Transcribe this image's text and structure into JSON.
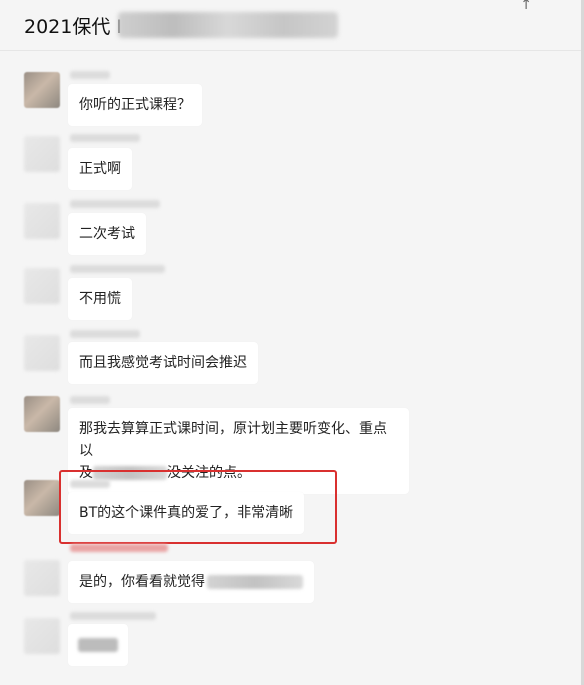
{
  "header": {
    "title": "2021保代 I",
    "pin_icon": "↑"
  },
  "messages": [
    {
      "text": "你听的正式课程？"
    },
    {
      "text": "正式啊"
    },
    {
      "text": "二次考试"
    },
    {
      "text": "不用慌"
    },
    {
      "text": "而且我感觉考试时间会推迟"
    },
    {
      "line1": "那我去算算正式课时间，原计划主要听变化、重点以",
      "line2_prefix": "及",
      "line2_suffix": "没关注的点。"
    },
    {
      "text": "BT的这个课件真的爱了，非常清晰"
    },
    {
      "text": "是的，你看看就觉得"
    }
  ],
  "colors": {
    "highlight": "#d9302f",
    "background": "#f5f5f5",
    "bubble": "#ffffff"
  }
}
